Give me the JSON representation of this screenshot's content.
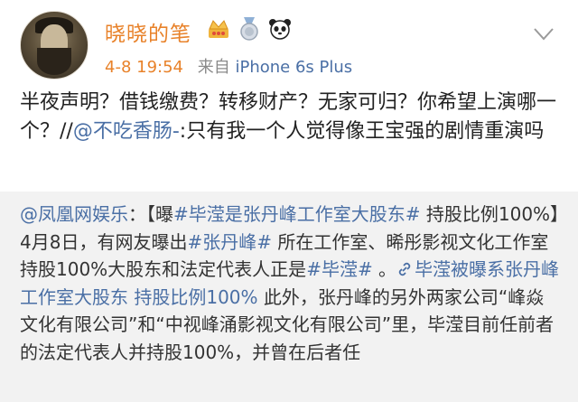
{
  "post": {
    "username": "晓晓的笔",
    "time": "4-8 19:54",
    "source_prefix": "来自",
    "source": "iPhone 6s Plus",
    "text_part1": "半夜声明？借钱缴费？转移财产？无家可归？你希望上演哪一个？//",
    "mention": "@不吃香肠-",
    "text_part2": ":只有我一个人觉得像王宝强的剧情重演吗"
  },
  "repost": {
    "author": "@凤凰网娱乐",
    "t1": "：【曝",
    "hashtag1": "#毕滢是张丹峰工作室大股东#",
    "t2": " 持股比例100%】4月8日，有网友曝出",
    "hashtag2": "#张丹峰#",
    "t3": " 所在工作室、晞彤影视文化工作室持股100%大股东和法定代表人正是",
    "hashtag3": "#毕滢#",
    "t4": " 。",
    "link_text": "毕滢被曝系张丹峰工作室大股东 持股比例100%",
    "t5": " 此外，张丹峰的另外两家公司“峰焱文化有限公司”和“中视峰涌影视文化有限公司”里，毕滢目前任前者的法定代表人并持股100%，并曾在后者任"
  },
  "icons": {
    "badge1": "crown-badge-icon",
    "badge2": "medal-badge-icon",
    "badge3": "panda-icon",
    "menu": "chevron-down-icon",
    "link": "link-icon"
  },
  "colors": {
    "username": "#e8822a",
    "link": "#4a6fa5",
    "quote_bg": "#f2f2f2"
  }
}
